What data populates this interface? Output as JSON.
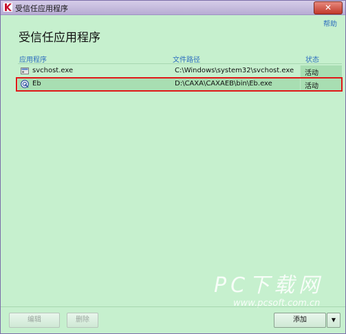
{
  "window": {
    "title": "受信任应用程序"
  },
  "help_label": "帮助",
  "heading": "受信任应用程序",
  "columns": {
    "app": "应用程序",
    "path": "文件路径",
    "status": "状态"
  },
  "rows": [
    {
      "name": "svchost.exe",
      "path": "C:\\Windows\\system32\\svchost.exe",
      "status": "活动",
      "icon": "exe-file-icon"
    },
    {
      "name": "Eb",
      "path": "D:\\CAXA\\CAXAEB\\bin\\Eb.exe",
      "status": "活动",
      "icon": "caxa-app-icon"
    }
  ],
  "buttons": {
    "edit": "编辑",
    "delete": "删除",
    "add": "添加"
  },
  "watermark": {
    "big": "PC下载网",
    "small": "www.pcsoft.com.cn"
  },
  "colors": {
    "background": "#c6f0ce",
    "highlight": "#e01818",
    "link": "#2e6fbe"
  }
}
